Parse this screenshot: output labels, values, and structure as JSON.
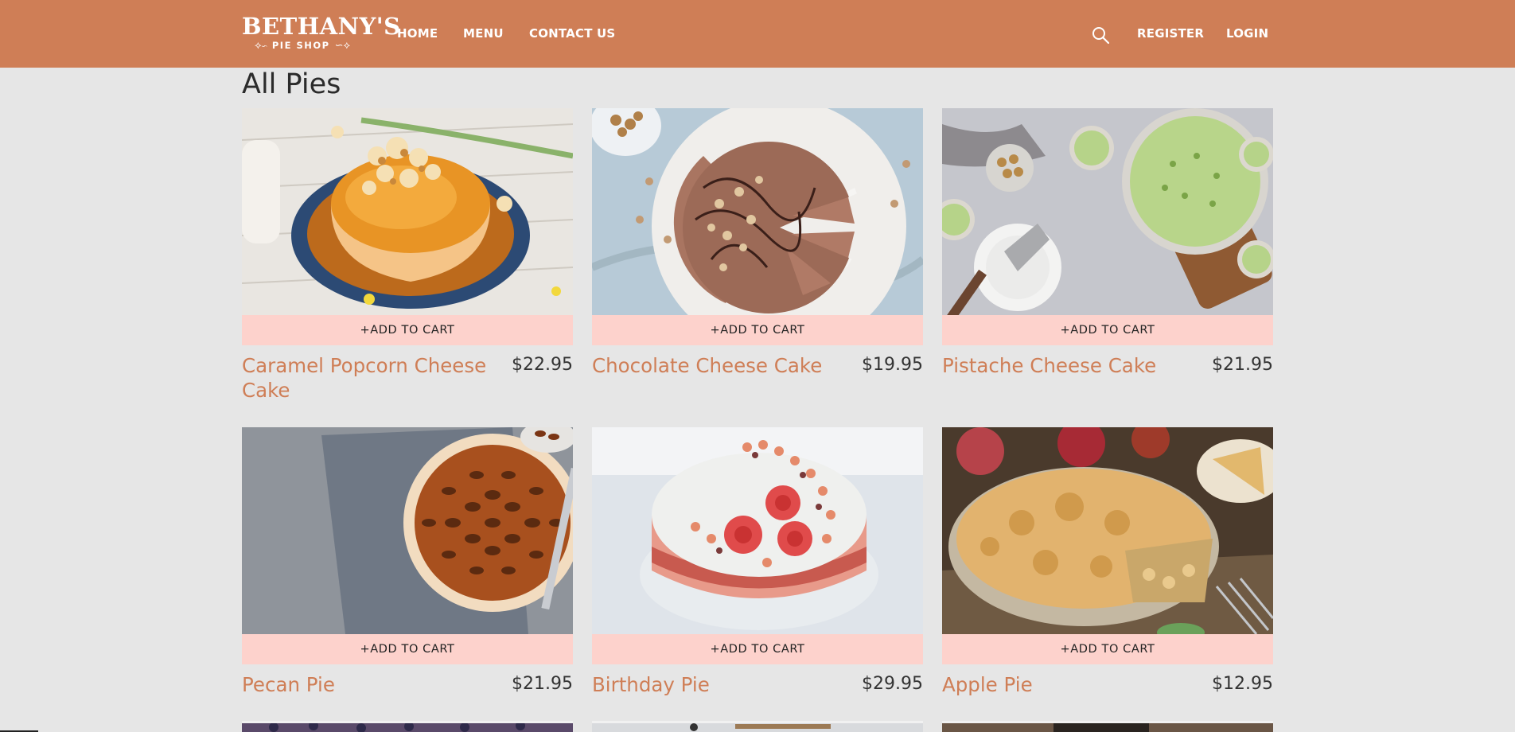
{
  "header": {
    "logo": {
      "main": "BETHANY'S",
      "sub": "PIE SHOP"
    },
    "nav": {
      "home": "HOME",
      "menu": "MENU",
      "contact": "CONTACT US",
      "register": "REGISTER",
      "login": "LOGIN"
    },
    "icons": {
      "search": "search-icon"
    },
    "colors": {
      "bar": "#cf7e56"
    }
  },
  "main": {
    "title": "All Pies",
    "add_to_cart_label": "+ADD TO CART",
    "products": [
      {
        "name": "Caramel Popcorn Cheese Cake",
        "price": "$22.95",
        "image": "caramel-popcorn-cheesecake-photo"
      },
      {
        "name": "Chocolate Cheese Cake",
        "price": "$19.95",
        "image": "chocolate-cheesecake-photo"
      },
      {
        "name": "Pistache Cheese Cake",
        "price": "$21.95",
        "image": "pistachio-cheesecake-photo"
      },
      {
        "name": "Pecan Pie",
        "price": "$21.95",
        "image": "pecan-pie-photo"
      },
      {
        "name": "Birthday Pie",
        "price": "$29.95",
        "image": "birthday-pie-photo"
      },
      {
        "name": "Apple Pie",
        "price": "$12.95",
        "image": "apple-pie-photo"
      }
    ],
    "colors": {
      "name": "#cf7e56",
      "cart_button": "#fdd2cc",
      "background": "#e6e6e6"
    }
  }
}
